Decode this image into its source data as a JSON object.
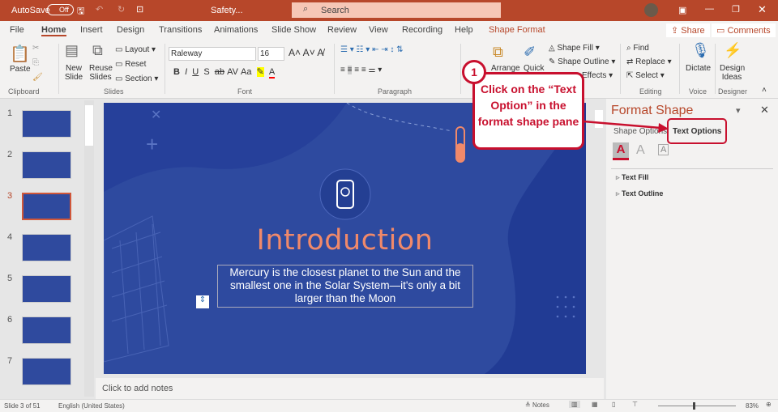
{
  "titlebar": {
    "autosave": "AutoSave",
    "toggle": "Off",
    "filename": "Safety...",
    "search": "Search"
  },
  "tabs": [
    "File",
    "Home",
    "Insert",
    "Design",
    "Transitions",
    "Animations",
    "Slide Show",
    "Review",
    "View",
    "Recording",
    "Help",
    "Shape Format"
  ],
  "share": "Share",
  "comments": "Comments",
  "ribbon": {
    "paste": "Paste",
    "new_slide": "New Slide",
    "reuse": "Reuse Slides",
    "layout": "Layout",
    "reset": "Reset",
    "section": "Section",
    "font": "Raleway",
    "size": "16",
    "arrange": "Arrange",
    "quick": "Quick",
    "shape_fill": "Shape Fill",
    "shape_outline": "Shape Outline",
    "effects": "Effects",
    "find": "Find",
    "replace": "Replace",
    "select": "Select",
    "dictate": "Dictate",
    "design_ideas": "Design Ideas",
    "groups": {
      "clipboard": "Clipboard",
      "slides": "Slides",
      "font": "Font",
      "paragraph": "Paragraph",
      "editing": "Editing",
      "voice": "Voice",
      "designer": "Designer"
    }
  },
  "thumbnails": [
    "1",
    "2",
    "3",
    "4",
    "5",
    "6",
    "7"
  ],
  "slide": {
    "title": "Introduction",
    "body": "Mercury is the closest planet to the Sun and the smallest one in the Solar System—it's only a bit larger than the Moon"
  },
  "notes": "Click to add notes",
  "pane": {
    "title": "Format Shape",
    "tab_shape": "Shape Options",
    "tab_text": "Text Options",
    "text_fill": "Text Fill",
    "text_outline": "Text Outline"
  },
  "callout": {
    "number": "1",
    "text": "Click on the “Text Option” in the format shape pane"
  },
  "status": {
    "slide": "Slide 3 of 51",
    "language": "English (United States)",
    "notes": "Notes",
    "zoom": "83%"
  },
  "colors": {
    "accent": "#b7472a",
    "callout": "#c8102e",
    "slide_bg": "#2e4a9f",
    "title": "#f0896a"
  }
}
